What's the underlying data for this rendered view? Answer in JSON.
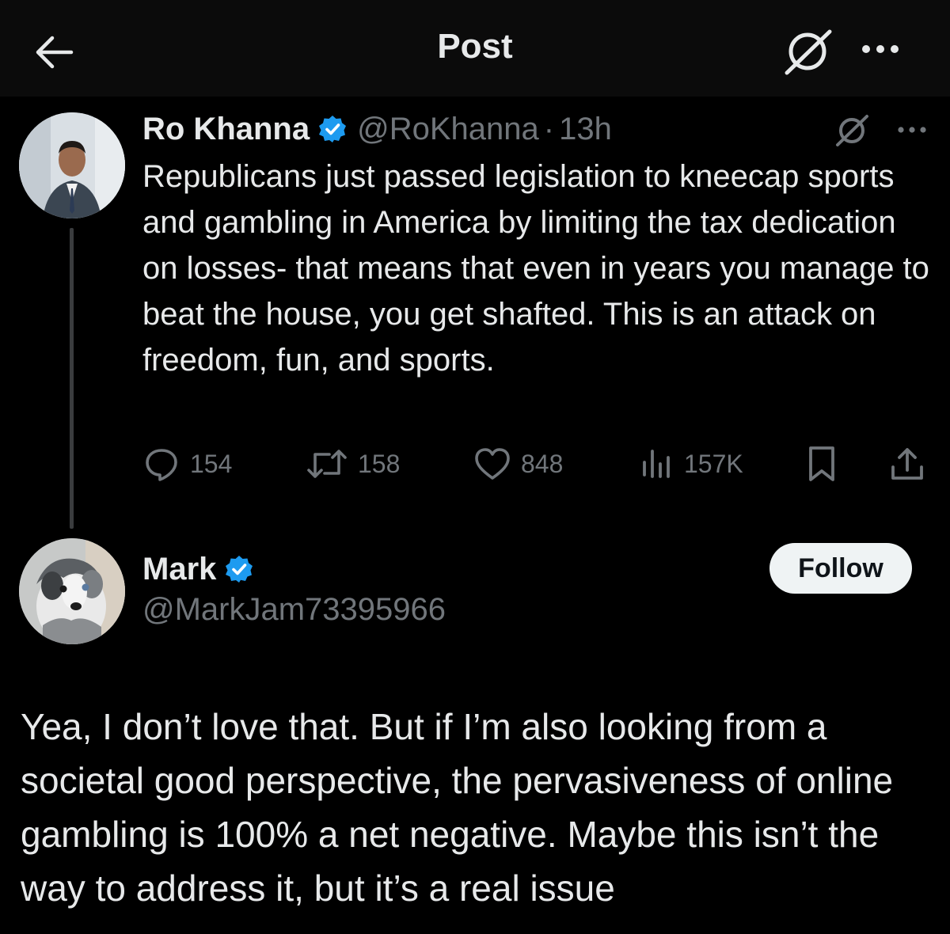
{
  "header": {
    "title": "Post",
    "back_icon": "arrow-left-icon",
    "grok_icon": "grok-icon",
    "more_icon": "more-horizontal-icon"
  },
  "original_post": {
    "author_name": "Ro Khanna",
    "verified": true,
    "handle": "@RoKhanna",
    "separator": "·",
    "time": "13h",
    "text": "Republicans just passed legislation to kneecap sports and gambling in America by limiting the tax dedication on losses- that means that even in years you manage to beat the house, you get shafted. This is an attack on freedom, fun, and sports.",
    "actions": {
      "replies": "154",
      "reposts": "158",
      "likes": "848",
      "views": "157K"
    }
  },
  "reply_post": {
    "author_name": "Mark",
    "verified": true,
    "handle": "@MarkJam73395966",
    "follow_label": "Follow",
    "text": "Yea, I don’t love that. But if I’m also looking from a societal good perspective, the pervasiveness of online gambling is 100% a net negative. Maybe this isn’t the way to address it, but it’s a real issue"
  },
  "colors": {
    "background": "#000000",
    "header_bg": "#0b0b0b",
    "text_primary": "#e7e9ea",
    "text_secondary": "#71767b",
    "verified_blue": "#1d9bf0",
    "follow_bg": "#eff3f4"
  }
}
